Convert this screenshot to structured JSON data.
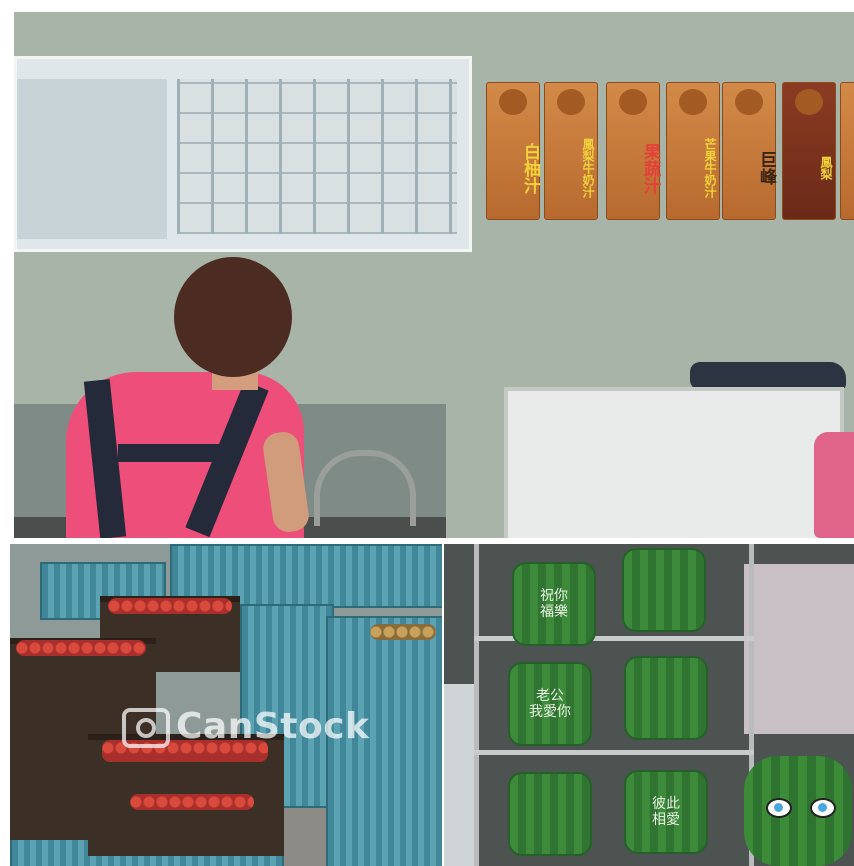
{
  "top_panel": {
    "signs": [
      {
        "text": "白柚汁"
      },
      {
        "text": "鳳梨牛奶汁"
      },
      {
        "text": "果蔬汁"
      },
      {
        "text": "芒果牛奶汁"
      },
      {
        "text": "巨峰"
      },
      {
        "text": "鳳梨"
      }
    ]
  },
  "bottom_left_panel": {
    "watermark": "CanStock"
  },
  "bottom_right_panel": {
    "melon_labels": [
      "祝你\n福樂",
      "",
      "老公\n我愛你",
      "",
      "",
      "彼此\n相愛"
    ]
  },
  "colors": {
    "wall": "#a9b4a8",
    "shirt": "#ee4f7a",
    "crate": "#3f8799",
    "melon": "#3d8b3a"
  }
}
